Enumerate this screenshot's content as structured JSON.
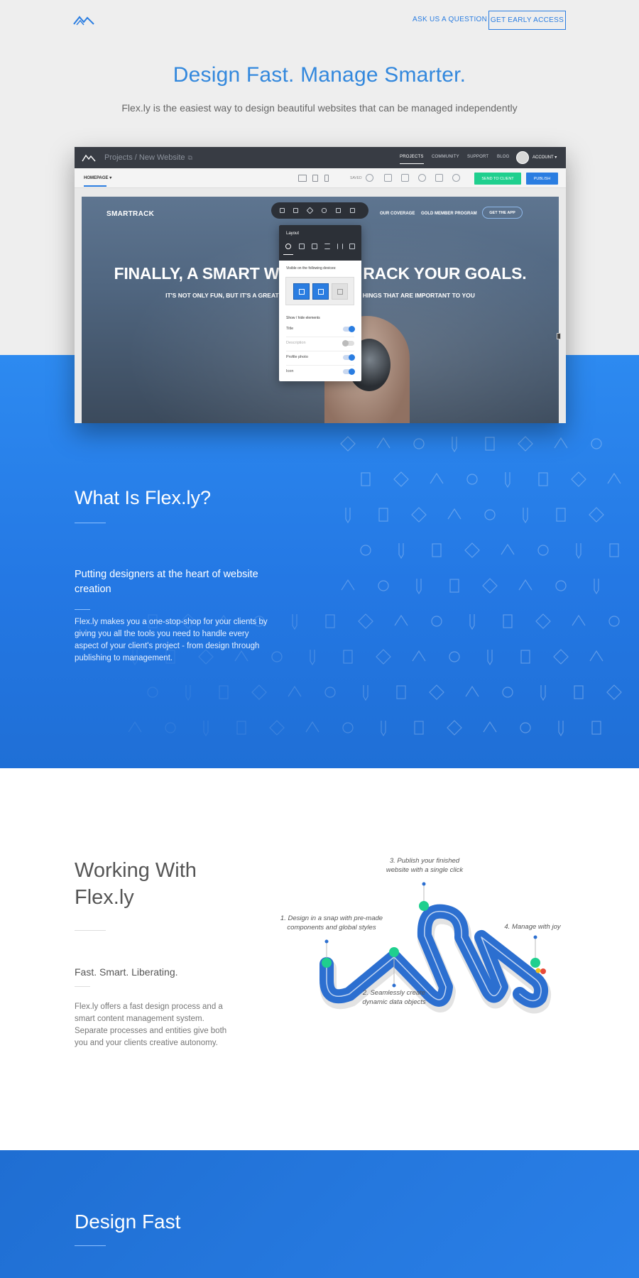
{
  "header": {
    "ask_link": "ASK US A QUESTION",
    "early_access": "GET EARLY ACCESS"
  },
  "hero": {
    "title": "Design Fast. Manage Smarter.",
    "subtitle": "Flex.ly is the easiest way to design beautiful websites that can be managed independently"
  },
  "app": {
    "breadcrumb": "Projects / New Website",
    "nav": [
      "PROJECTS",
      "COMMUNITY",
      "SUPPORT",
      "BLOG"
    ],
    "account": "ACCOUNT",
    "page_select": "HOMEPAGE",
    "saved": "SAVED",
    "send_button": "SEND TO CLIENT",
    "publish_button": "PUBLISH",
    "site": {
      "logo": "SMARTRACK",
      "nav": [
        "OUR COVERAGE",
        "GOLD MEMBER PROGRAM"
      ],
      "cta": "GET THE APP",
      "headline_left": "FINALLY, A SMART W",
      "headline_right": "RACK YOUR GOALS.",
      "subline_left": "IT'S NOT ONLY FUN, BUT IT'S A GREAT",
      "subline_right": "HINGS THAT ARE IMPORTANT TO YOU"
    },
    "panel": {
      "title": "Layout",
      "devices_label": "Visible on the following devices:",
      "elements_label": "Show / hide elements",
      "elements": [
        {
          "label": "Title",
          "on": true
        },
        {
          "label": "Description",
          "on": false
        },
        {
          "label": "Profile photo",
          "on": true
        },
        {
          "label": "Icon",
          "on": true
        }
      ]
    }
  },
  "what": {
    "title": "What Is Flex.ly?",
    "subtitle": "Putting designers at the heart of website creation",
    "body": "Flex.ly makes you a one-stop-shop for your clients by giving you all the tools you need to handle every aspect of your client's project - from design through publishing to management."
  },
  "working": {
    "title": "Working With Flex.ly",
    "subtitle": "Fast. Smart. Liberating.",
    "body": "Flex.ly offers a fast design process and a smart content management system. Separate processes and entities give both you and your clients creative autonomy.",
    "steps": [
      "1. Design in a snap with pre-made components and global styles",
      "2. Seamlessly create dynamic data objects",
      "3. Publish your finished website with a single click",
      "4. Manage with joy"
    ]
  },
  "design_fast": {
    "title": "Design Fast"
  },
  "colors": {
    "accent": "#2a7de1",
    "green": "#1fcf8e",
    "dark": "#2c3037"
  }
}
